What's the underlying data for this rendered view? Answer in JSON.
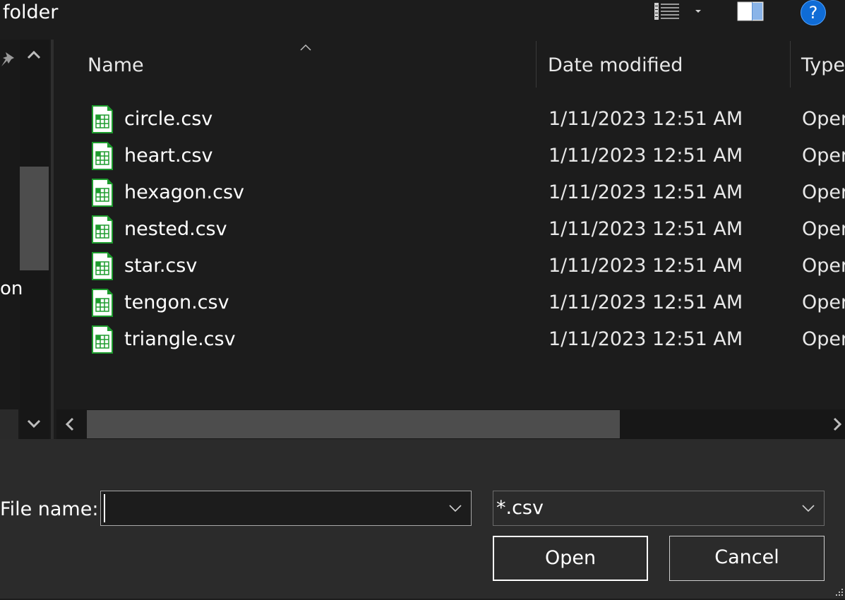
{
  "titlebar": {
    "label": "folder"
  },
  "toolbar": {
    "view_icon": "details-view-icon",
    "view_dropdown_icon": "chevron-down-icon",
    "preview_pane_icon": "preview-pane-icon",
    "help_label": "?"
  },
  "nav": {
    "partial_label": "on",
    "pin_icon": "pin-icon"
  },
  "list": {
    "columns": [
      {
        "label": "Name"
      },
      {
        "label": "Date modified"
      },
      {
        "label": "Type"
      }
    ],
    "rows": [
      {
        "name": "circle.csv",
        "date": "1/11/2023 12:51 AM",
        "type": "Oper"
      },
      {
        "name": "heart.csv",
        "date": "1/11/2023 12:51 AM",
        "type": "Oper"
      },
      {
        "name": "hexagon.csv",
        "date": "1/11/2023 12:51 AM",
        "type": "Oper"
      },
      {
        "name": "nested.csv",
        "date": "1/11/2023 12:51 AM",
        "type": "Oper"
      },
      {
        "name": "star.csv",
        "date": "1/11/2023 12:51 AM",
        "type": "Oper"
      },
      {
        "name": "tengon.csv",
        "date": "1/11/2023 12:51 AM",
        "type": "Oper"
      },
      {
        "name": "triangle.csv",
        "date": "1/11/2023 12:51 AM",
        "type": "Oper"
      }
    ],
    "file_icon": "spreadsheet-file-icon"
  },
  "bottom": {
    "filename_label": "File name:",
    "filename_value": "",
    "filter_value": "*.csv",
    "open_label": "Open",
    "cancel_label": "Cancel"
  },
  "colors": {
    "background": "#1c1c1c",
    "panel": "#2b2b2b",
    "accent": "#0f6cd6",
    "file_icon_green": "#1e9c2e"
  }
}
